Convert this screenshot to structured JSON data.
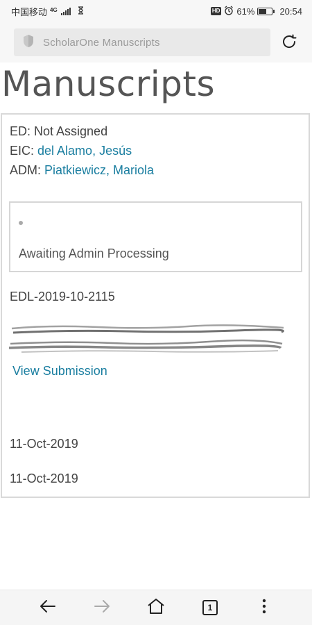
{
  "status_bar": {
    "carrier": "中国移动",
    "network": "4G",
    "battery_percent": "61%",
    "battery_level": 0.61,
    "time": "20:54",
    "icons": [
      "signal-icon",
      "hourglass-icon",
      "hd-icon",
      "alarm-icon",
      "battery-icon"
    ]
  },
  "browser": {
    "url_text": "ScholarOne Manuscripts",
    "tab_count": "1"
  },
  "page": {
    "title": "Manuscripts"
  },
  "manuscript": {
    "ed_label": "ED: ",
    "ed_value": "Not Assigned",
    "eic_label": "EIC: ",
    "eic_value": "del Alamo, Jesús",
    "adm_label": "ADM: ",
    "adm_value": "Piatkiewicz, Mariola",
    "status": "Awaiting Admin Processing",
    "id": "EDL-2019-10-2115",
    "view_link": "View Submission",
    "date_submitted": "11-Oct-2019",
    "date_updated": "11-Oct-2019"
  },
  "colors": {
    "link": "#1a7ea0",
    "border": "#d9d9d9"
  }
}
